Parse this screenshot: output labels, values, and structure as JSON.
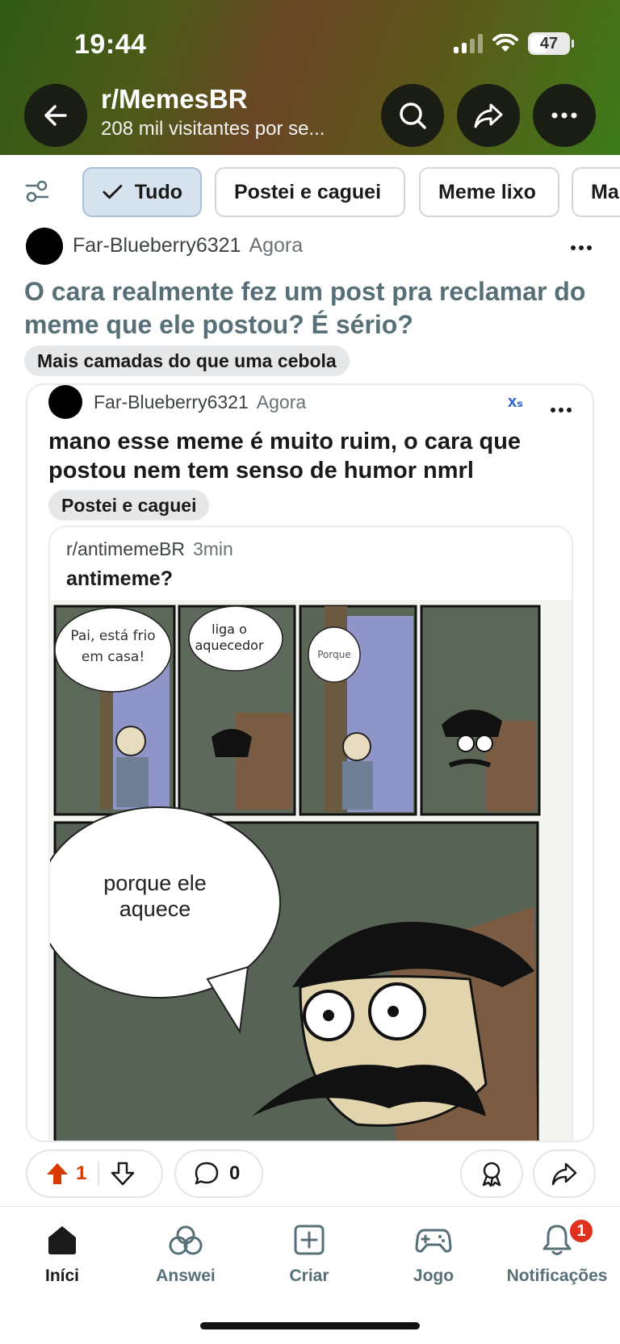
{
  "status_bar": {
    "time": "19:44",
    "battery": "47",
    "battery_fraction": 0.47
  },
  "header": {
    "subreddit": "r/MemesBR",
    "visitors": "208 mil visitantes por se..."
  },
  "filters": [
    {
      "label": "Tudo",
      "active": true
    },
    {
      "label": "Postei e caguei",
      "active": false
    },
    {
      "label": "Meme lixo",
      "active": false
    },
    {
      "label": "Ma",
      "active": false
    }
  ],
  "post": {
    "author": "Far-Blueberry6321",
    "time": "Agora",
    "title": "O cara realmente fez um post pra reclamar do meme que ele postou? É sério?",
    "flair": "Mais camadas do que uma cebola",
    "crosspost": {
      "author": "Far-Blueberry6321",
      "time": "Agora",
      "translate_icon": "xₛ",
      "body": "mano esse meme é muito ruim, o cara que postou nem tem senso de humor nmrl",
      "flair": "Postei e caguei",
      "inner": {
        "subreddit": "r/antimemeBR",
        "time": "3min",
        "title": "antimeme?",
        "comic": {
          "bubble1": [
            "Pai, está frio",
            "em casa!"
          ],
          "bubble2": [
            "liga o",
            "aquecedor"
          ],
          "bubble3": "Porque",
          "bubble4": [
            "porque ele",
            "aquece"
          ]
        }
      }
    },
    "votes": "1",
    "comments": "0"
  },
  "bottom_nav": [
    {
      "label": "Iníci",
      "icon": "home-icon",
      "active": true
    },
    {
      "label": "Answei",
      "icon": "answers-icon",
      "active": false
    },
    {
      "label": "Criar",
      "icon": "create-icon",
      "active": false
    },
    {
      "label": "Jogo",
      "icon": "gamepad-icon",
      "active": false
    },
    {
      "label": "Notificações",
      "icon": "bell-icon",
      "active": false,
      "badge": "1"
    }
  ],
  "colors": {
    "upvote": "#d93a00",
    "badge": "#e0301e",
    "title_gray": "#576f76",
    "active_chip": "#d6e2ee"
  }
}
